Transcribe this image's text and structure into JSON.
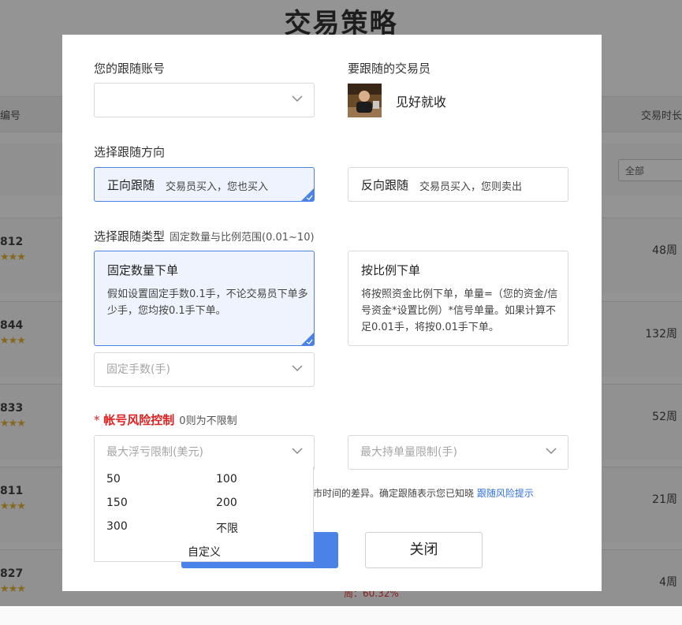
{
  "background": {
    "page_title": "交易策略",
    "table": {
      "col_left": "编号",
      "col_right": "交易时长",
      "filter_value": "全部",
      "rows": [
        {
          "num": "812",
          "stars": "★★★",
          "duration": "48周"
        },
        {
          "num": "844",
          "stars": "★★★",
          "duration": "132周"
        },
        {
          "num": "833",
          "stars": "★★★",
          "duration": "52周"
        },
        {
          "num": "811",
          "stars": "★★★",
          "duration": "21周"
        },
        {
          "num": "827",
          "stars": "★★★",
          "duration": "4周"
        }
      ],
      "partial_pct": "周：60.32%"
    }
  },
  "modal": {
    "account_label": "您的跟随账号",
    "account_value": "",
    "trader_label": "要跟随的交易员",
    "trader_name": "见好就收",
    "direction": {
      "label": "选择跟随方向",
      "options": [
        {
          "title": "正向跟随",
          "desc": "交易员买入，您也买入",
          "selected": true
        },
        {
          "title": "反向跟随",
          "desc": "交易员买入，您则卖出",
          "selected": false
        }
      ]
    },
    "follow_type": {
      "label": "选择跟随类型",
      "sublabel": "固定数量与比例范围(0.01~10)",
      "options": [
        {
          "title": "固定数量下单",
          "desc": "假如设置固定手数0.1手，不论交易员下单多少手，您均按0.1手下单。",
          "selected": true
        },
        {
          "title": "按比例下单",
          "desc": "将按照资金比例下单，单量=（您的资金/信号资金*设置比例）*信号单量。如果计算不足0.01手，将按0.01手下单。",
          "selected": false
        }
      ],
      "lots_placeholder": "固定手数(手)"
    },
    "risk": {
      "star": "*",
      "label": "帐号风险控制",
      "sublabel": "0则为不限制",
      "max_loss_placeholder": "最大浮亏限制(美元)",
      "max_position_placeholder": "最大持单量限制(手)",
      "dropdown_options": [
        "50",
        "100",
        "150",
        "200",
        "300",
        "不限",
        "自定义"
      ]
    },
    "notice_text": "休市时间的差异。确定跟随表示您已知晓",
    "notice_link": "跟随风险提示",
    "close_label": "关闭"
  },
  "colors": {
    "accent": "#4a82e8",
    "selected_bg": "#eef3fd",
    "risk_red": "#e02020",
    "link": "#2f6fe0",
    "stars": "#e6b433"
  }
}
